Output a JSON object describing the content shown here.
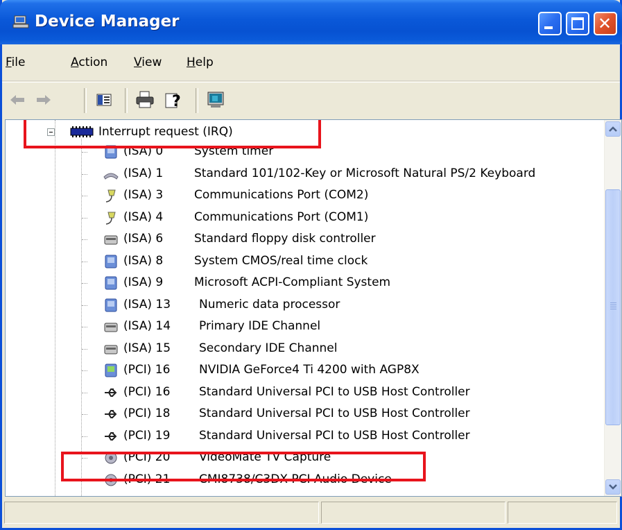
{
  "window": {
    "title": "Device Manager"
  },
  "menu": [
    {
      "label": "File",
      "accel": "F",
      "rest": "ile"
    },
    {
      "label": "Action",
      "accel": "A",
      "rest": "ction"
    },
    {
      "label": "View",
      "accel": "V",
      "rest": "iew"
    },
    {
      "label": "Help",
      "accel": "H",
      "rest": "elp"
    }
  ],
  "toolbar": {
    "icons": [
      "back-arrow-icon",
      "forward-arrow-icon",
      "properties-pane-icon",
      "print-icon",
      "help-icon",
      "scan-hardware-icon"
    ]
  },
  "tree": {
    "root_label": "Interrupt request (IRQ)",
    "items": [
      {
        "bus": "(ISA) 0",
        "name": "System timer",
        "icon": "system-device-icon"
      },
      {
        "bus": "(ISA) 1",
        "name": "Standard 101/102-Key or Microsoft Natural PS/2 Keyboard",
        "icon": "keyboard-icon"
      },
      {
        "bus": "(ISA) 3",
        "name": "Communications Port (COM2)",
        "icon": "port-icon"
      },
      {
        "bus": "(ISA) 4",
        "name": "Communications Port (COM1)",
        "icon": "port-icon"
      },
      {
        "bus": "(ISA) 6",
        "name": "Standard floppy disk controller",
        "icon": "controller-icon"
      },
      {
        "bus": "(ISA) 8",
        "name": "System CMOS/real time clock",
        "icon": "system-device-icon"
      },
      {
        "bus": "(ISA) 9",
        "name": "Microsoft ACPI-Compliant System",
        "icon": "system-device-icon"
      },
      {
        "bus": "(ISA) 13",
        "name": "Numeric data processor",
        "icon": "system-device-icon"
      },
      {
        "bus": "(ISA) 14",
        "name": "Primary IDE Channel",
        "icon": "controller-icon"
      },
      {
        "bus": "(ISA) 15",
        "name": "Secondary IDE Channel",
        "icon": "controller-icon"
      },
      {
        "bus": "(PCI) 16",
        "name": "NVIDIA GeForce4 Ti 4200 with AGP8X",
        "icon": "display-adapter-icon"
      },
      {
        "bus": "(PCI) 16",
        "name": "Standard Universal PCI to USB Host Controller",
        "icon": "usb-icon"
      },
      {
        "bus": "(PCI) 18",
        "name": "Standard Universal PCI to USB Host Controller",
        "icon": "usb-icon"
      },
      {
        "bus": "(PCI) 19",
        "name": "Standard Universal PCI to USB Host Controller",
        "icon": "usb-icon"
      },
      {
        "bus": "(PCI) 20",
        "name": "VideoMate TV Capture",
        "icon": "sound-video-icon"
      },
      {
        "bus": "(PCI) 21",
        "name": "CMI8738/C3DX PCI Audio Device",
        "icon": "sound-video-icon"
      }
    ]
  },
  "colors": {
    "titlebar": "#0a58d8",
    "highlight": "#e8141c",
    "window_bg": "#ece9d8"
  }
}
